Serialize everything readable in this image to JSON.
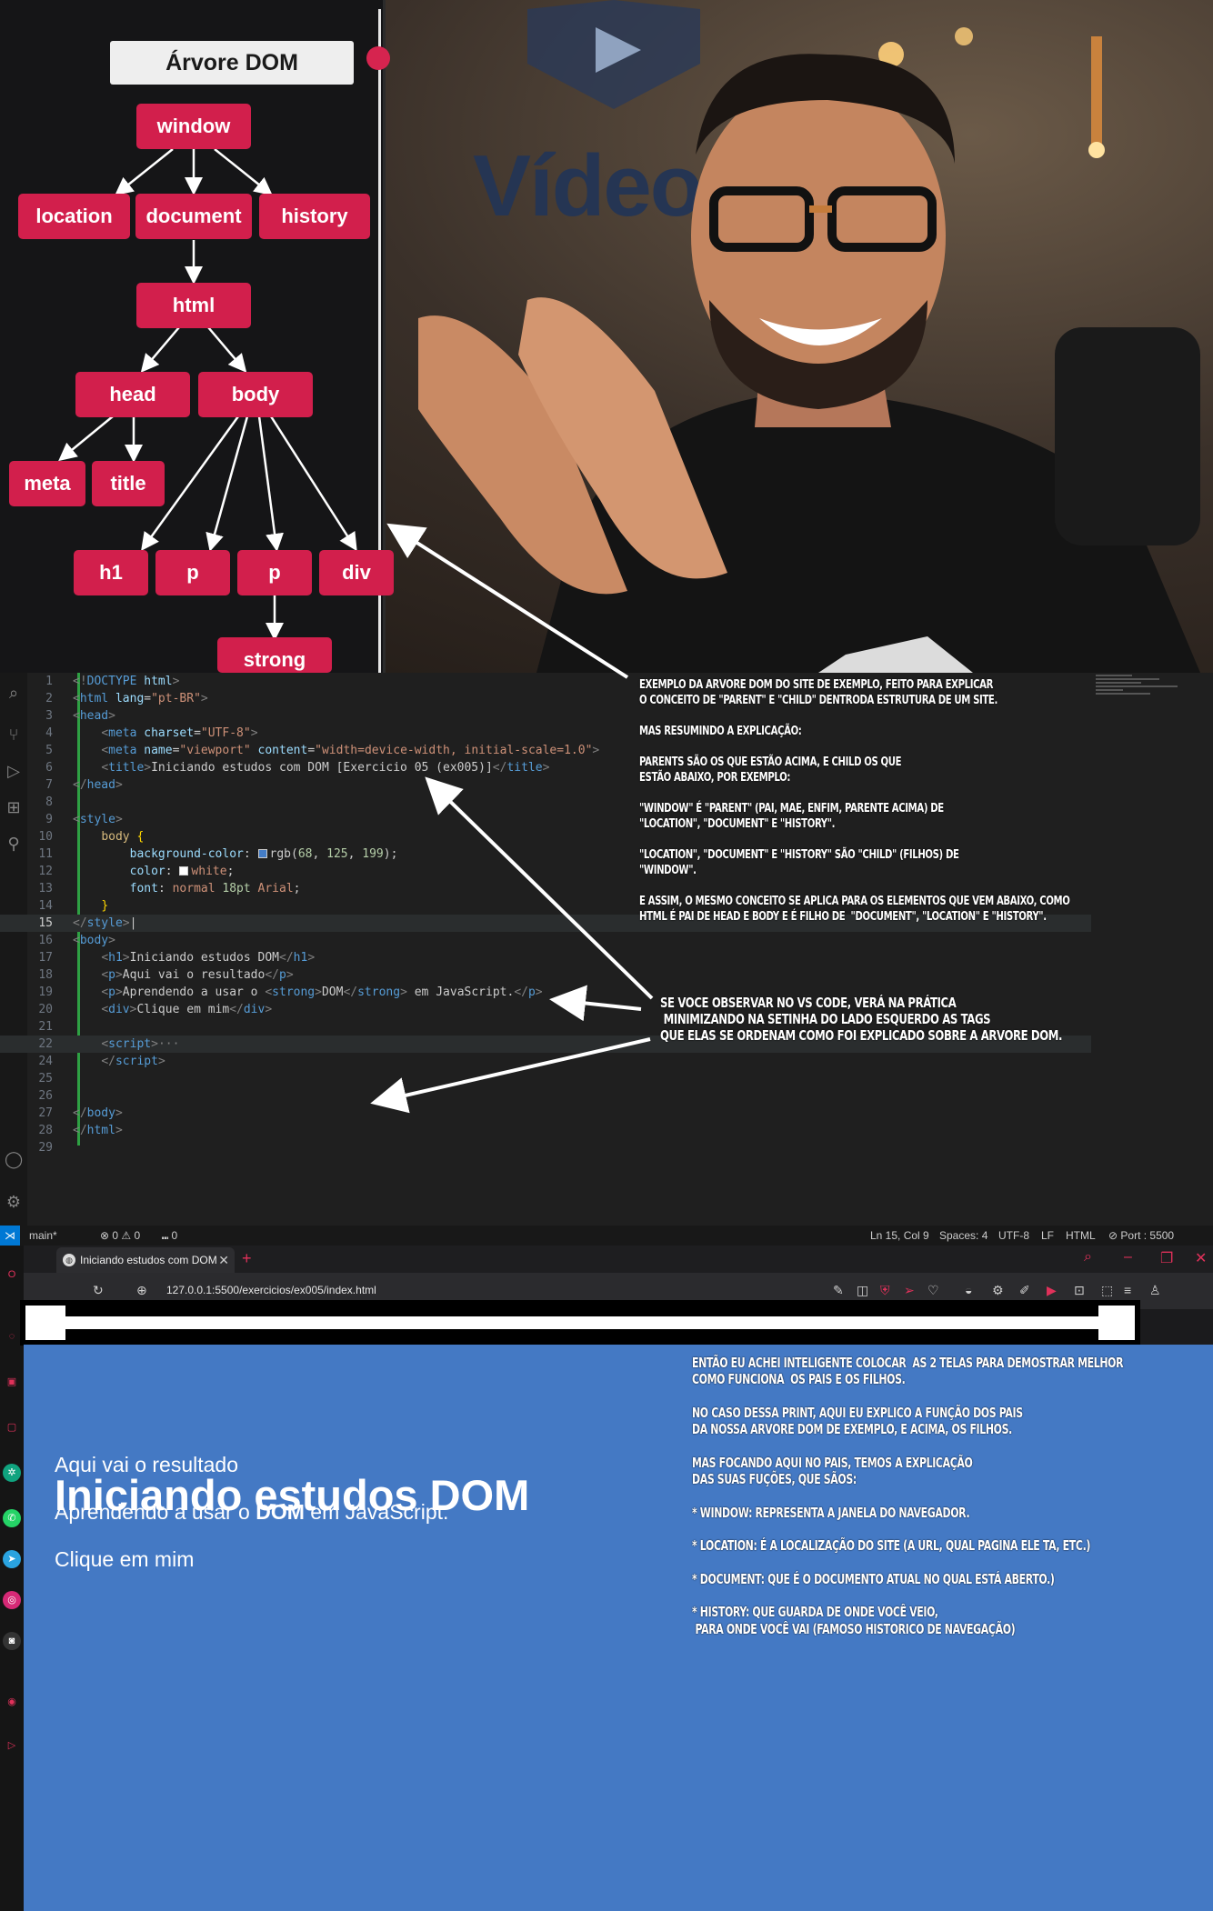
{
  "video": {
    "tree_title": "Árvore DOM",
    "logo_text": "Vídeo",
    "nodes": {
      "window": "window",
      "location": "location",
      "document": "document",
      "history": "history",
      "html": "html",
      "head": "head",
      "body": "body",
      "meta": "meta",
      "title": "title",
      "h1": "h1",
      "p1": "p",
      "p2": "p",
      "div": "div",
      "strong": "strong"
    }
  },
  "annotations": {
    "tree": "EXEMPLO DA ARVORE DOM DO SITE DE EXEMPLO, FEITO PARA EXPLICAR\nO CONCEITO DE \"PARENT\" E \"CHILD\" DENTRODA ESTRUTURA DE UM SITE.\n\nMAS RESUMINDO A EXPLICAÇÃO:\n\nPARENTS SÃO OS QUE ESTÃO ACIMA, E CHILD OS QUE\nESTÃO ABAIXO, POR EXEMPLO:\n\n\"WINDOW\" É \"PARENT\" (PAI, MAE, ENFIM, PARENTE ACIMA) DE\n\"LOCATION\", \"DOCUMENT\" E \"HISTORY\".\n\n\"LOCATION\", \"DOCUMENT\" E \"HISTORY\" SÃO \"CHILD\" (FILHOS) DE\n\"WINDOW\".\n\nE ASSIM, O MESMO CONCEITO SE APLICA PARA OS ELEMENTOS QUE VEM ABAIXO, COMO\nHTML É PAI DE HEAD E BODY E É FILHO DE  \"DOCUMENT\", \"LOCATION\" E \"HISTORY\".",
    "vscode": "SE VOCE OBSERVAR NO VS CODE, VERÁ NA PRÁTICA\n MINIMIZANDO NA SETINHA DO LADO ESQUERDO AS TAGS\nQUE ELAS SE ORDENAM COMO FOI EXPLICADO SOBRE A ARVORE DOM.",
    "browser": "ENTÃO EU ACHEI INTELIGENTE COLOCAR  AS 2 TELAS PARA DEMOSTRAR MELHOR\nCOMO FUNCIONA  OS PAIS E OS FILHOS.\n\nNO CASO DESSA PRINT, AQUI EU EXPLICO A FUNÇÃO DOS PAIS\nDA NOSSA ARVORE DOM DE EXEMPLO, E ACIMA, OS FILHOS.\n\nMAS FOCANDO AQUI NO PAIS, TEMOS A EXPLICAÇÃO\nDAS SUAS FUÇÕES, QUE SÃOS:\n\n* WINDOW: REPRESENTA A JANELA DO NAVEGADOR.\n\n* LOCATION: É A LOCALIZAÇÃO DO SITE (A URL, QUAL PAGINA ELE TA, ETC.)\n\n* DOCUMENT: QUE É O DOCUMENTO ATUAL NO QUAL ESTÁ ABERTO.)\n\n* HISTORY: QUE GUARDA DE ONDE VOCÊ VEIO,\n PARA ONDE VOCÊ VAI (FAMOSO HISTORICO DE NAVEGAÇÃO)"
  },
  "editor": {
    "line_numbers": [
      "1",
      "2",
      "3",
      "4",
      "5",
      "6",
      "7",
      "8",
      "9",
      "10",
      "11",
      "12",
      "13",
      "14",
      "15",
      "16",
      "17",
      "18",
      "19",
      "20",
      "21",
      "22",
      "24",
      "25",
      "26",
      "27",
      "28",
      "29"
    ],
    "status": {
      "branch": "main*",
      "problems": "⊗ 0 ⚠ 0",
      "ports": "⑉ 0",
      "position": "Ln 15, Col 9",
      "spaces": "Spaces: 4",
      "encoding": "UTF-8",
      "eol": "LF",
      "language": "HTML",
      "port": "⊘ Port : 5500"
    }
  },
  "browser": {
    "tab_title": "Iniciando estudos com DOM",
    "url": "127.0.0.1:5500/exercicios/ex005/index.html",
    "page": {
      "h1": "Iniciando estudos DOM",
      "p1": "Aqui vai o resultado",
      "p2_before": "Aprendendo a usar o ",
      "p2_strong": "DOM",
      "p2_after": " em JavaScript.",
      "div": "Clique em mim"
    },
    "page_bg": "#4479c4"
  },
  "colors": {
    "node": "#d21f4c",
    "accent_bar": "#e0315a"
  }
}
